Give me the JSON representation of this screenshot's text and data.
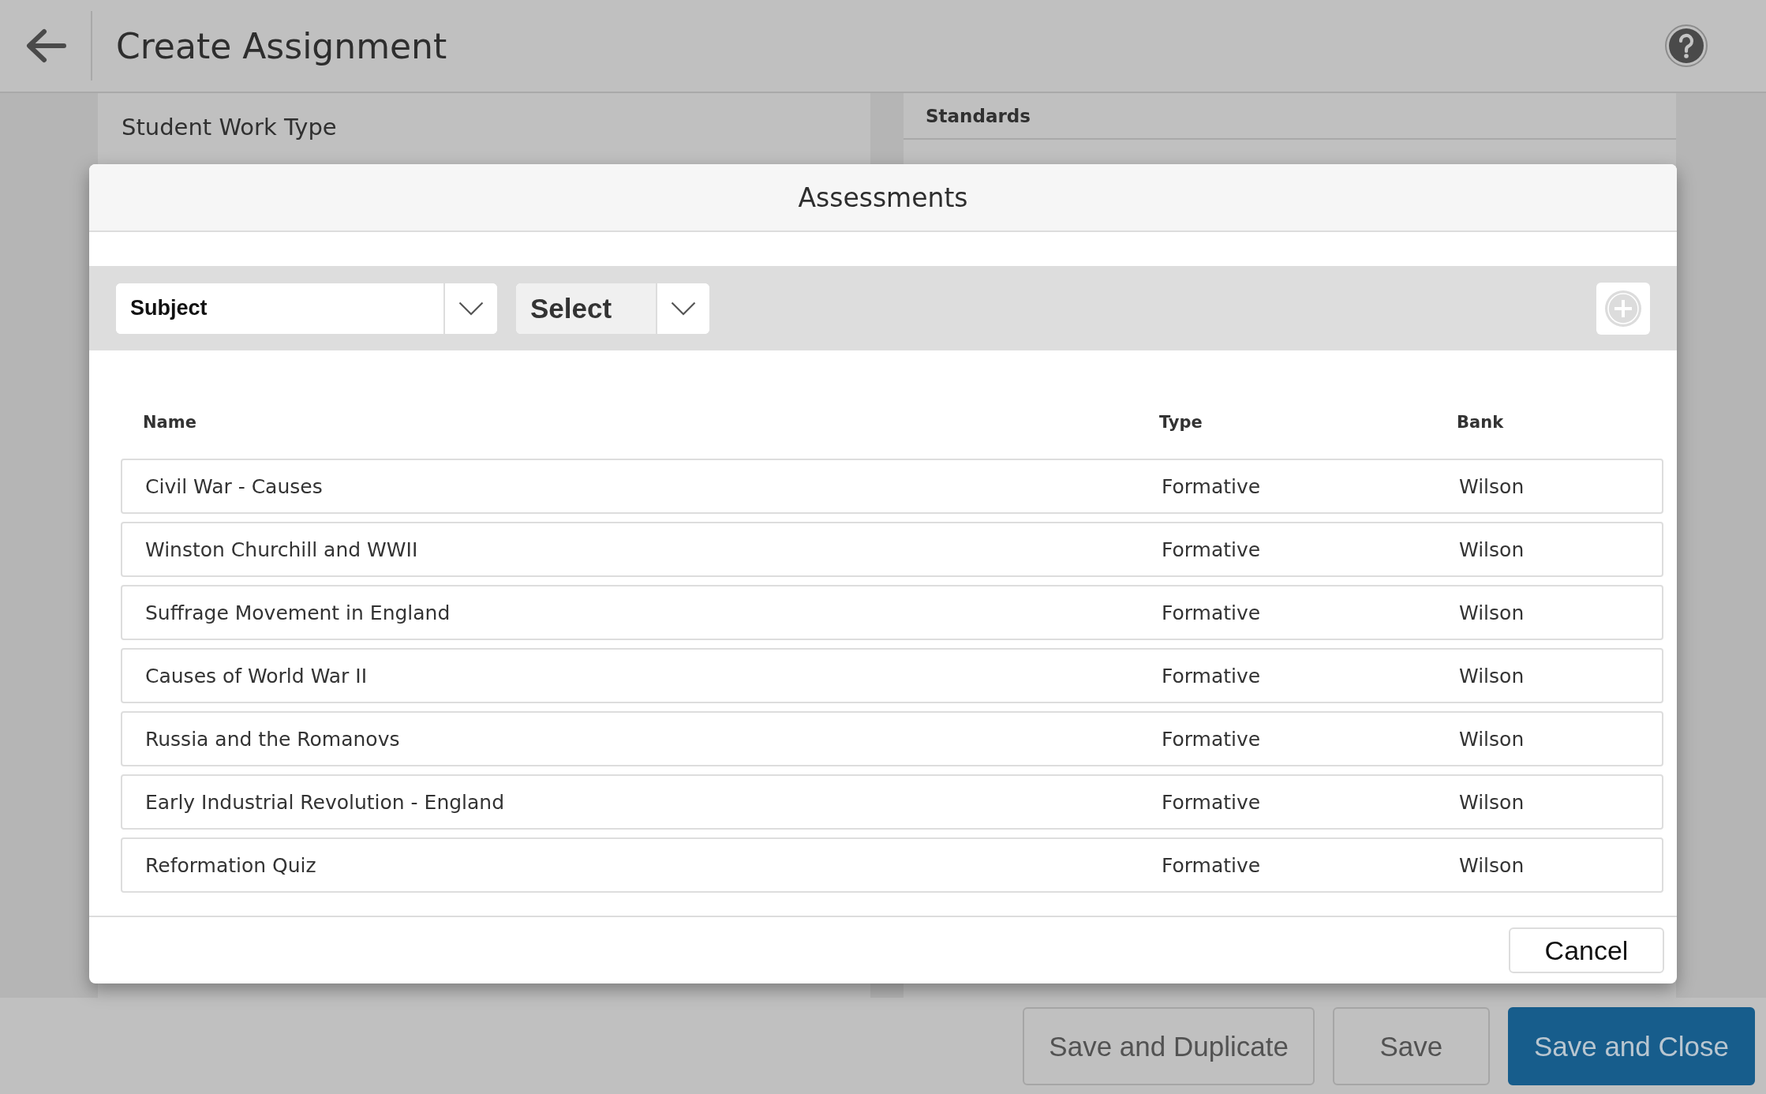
{
  "header": {
    "title": "Create Assignment"
  },
  "left_panel": {
    "label": "Student Work Type"
  },
  "right_panel": {
    "title": "Standards"
  },
  "modal": {
    "title": "Assessments",
    "filters": [
      {
        "kind": "wide",
        "label": "Subject"
      },
      {
        "kind": "compact",
        "label": "Select"
      }
    ],
    "add_button": {
      "disabled": true
    },
    "table": {
      "columns": [
        "Name",
        "Type",
        "Bank"
      ],
      "rows": [
        {
          "name": "Civil War - Causes",
          "type": "Formative",
          "bank": "Wilson"
        },
        {
          "name": "Winston Churchill and WWII",
          "type": "Formative",
          "bank": "Wilson"
        },
        {
          "name": "Suffrage Movement in England",
          "type": "Formative",
          "bank": "Wilson"
        },
        {
          "name": "Causes of World War II",
          "type": "Formative",
          "bank": "Wilson"
        },
        {
          "name": "Russia and the Romanovs",
          "type": "Formative",
          "bank": "Wilson"
        },
        {
          "name": "Early Industrial Revolution - England",
          "type": "Formative",
          "bank": "Wilson"
        },
        {
          "name": "Reformation Quiz",
          "type": "Formative",
          "bank": "Wilson"
        }
      ]
    },
    "buttons": [
      "Cancel"
    ]
  },
  "footer": {
    "buttons": [
      {
        "kind": "secondary",
        "label": "Save and Duplicate"
      },
      {
        "kind": "secondary",
        "label": "Save"
      },
      {
        "kind": "primary",
        "label": "Save and Close"
      }
    ]
  }
}
